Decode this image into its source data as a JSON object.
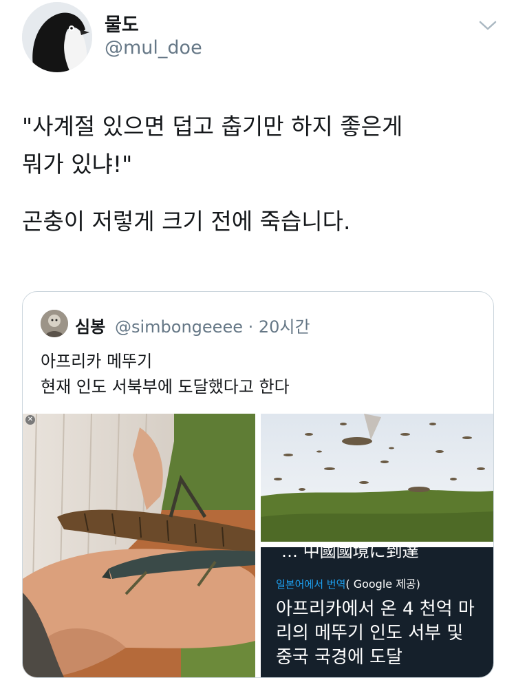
{
  "tweet": {
    "display_name": "물도",
    "handle": "@mul_doe",
    "lines": [
      "\"사계절 있으면 덥고 춥기만 하지 좋은게",
      "뭐가 있냐!\"",
      "곤충이 저렇게 크기 전에 죽습니다."
    ]
  },
  "quote": {
    "display_name": "심봉",
    "handle": "@simbongeeee",
    "time": "· 20시간",
    "lines": [
      "아프리카 메뚜기",
      "현재 인도 서북부에 도달했다고 한다"
    ]
  },
  "media": {
    "translation_label": "일본어에서 번역",
    "translation_provider": "( Google 제공)",
    "translation_lines": [
      "아프리카에서 온 4 천억 마",
      "리의 메뚜기 인도 서부 및",
      "중국 국경에 도달"
    ],
    "cut_off_text": "… 中國國境に到達"
  },
  "icons": {
    "chevron": "chevron-down-icon",
    "avatar": "penguin-avatar",
    "quote_avatar": "user-avatar"
  },
  "colors": {
    "secondary_text": "#657786",
    "border": "#ccd6dd",
    "link_blue": "#1da1f2",
    "dark_panel": "#15202b"
  }
}
